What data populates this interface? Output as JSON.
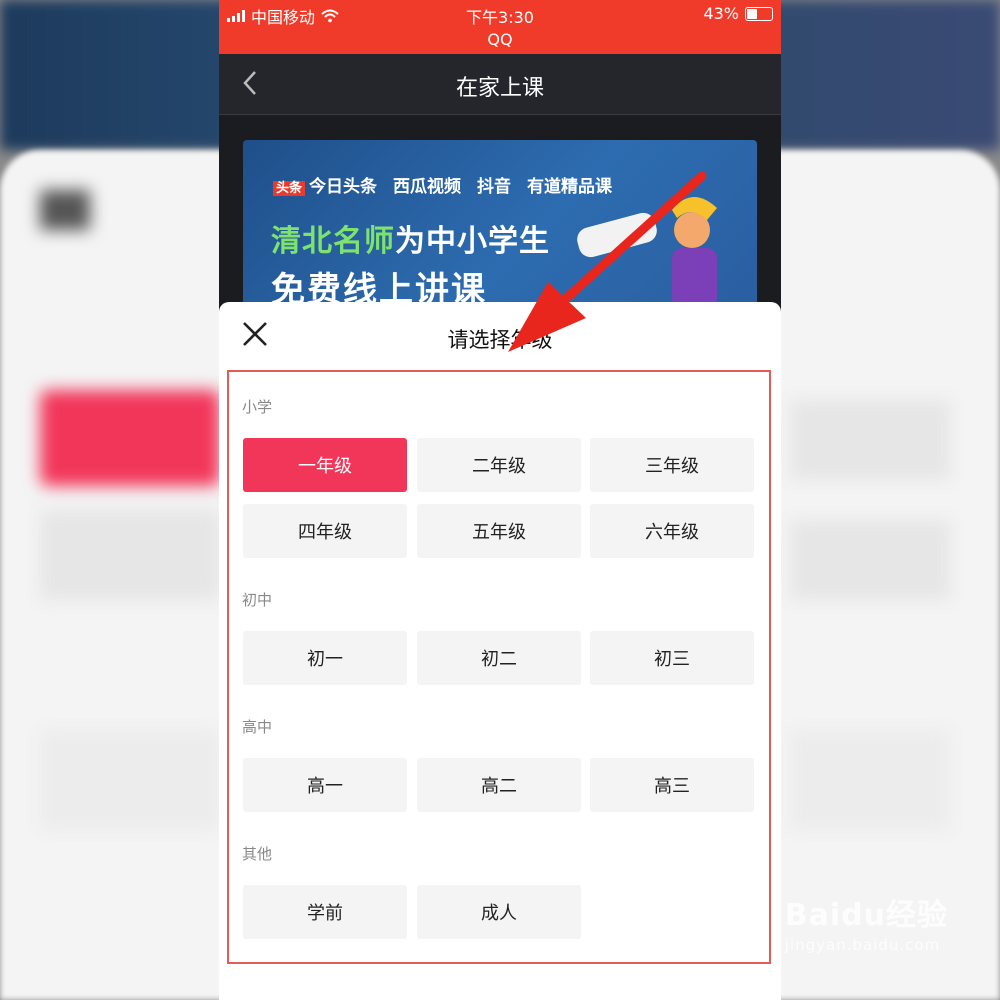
{
  "status_bar": {
    "carrier": "中国移动",
    "time": "下午3:30",
    "battery": "43%",
    "app_name": "QQ"
  },
  "nav": {
    "title": "在家上课",
    "back_icon": "chevron-left-icon"
  },
  "banner": {
    "brands": [
      "今日头条",
      "西瓜视频",
      "抖音",
      "有道精品课"
    ],
    "brand_badge": "头条",
    "headline_accent": "清北名师",
    "headline_rest": "为中小学生",
    "headline2": "免费线上讲课"
  },
  "sheet": {
    "title": "请选择年级",
    "close_icon": "close-icon",
    "sections": [
      {
        "label": "小学",
        "grades": [
          "一年级",
          "二年级",
          "三年级",
          "四年级",
          "五年级",
          "六年级"
        ]
      },
      {
        "label": "初中",
        "grades": [
          "初一",
          "初二",
          "初三"
        ]
      },
      {
        "label": "高中",
        "grades": [
          "高一",
          "高二",
          "高三"
        ]
      },
      {
        "label": "其他",
        "grades": [
          "学前",
          "成人"
        ]
      }
    ],
    "selected": "一年级"
  },
  "colors": {
    "status_bar": "#f03b2b",
    "selected_grade": "#f2365a",
    "annotation": "#e8261e"
  },
  "watermark": {
    "main": "Baidu经验",
    "sub": "jingyan.baidu.com"
  }
}
